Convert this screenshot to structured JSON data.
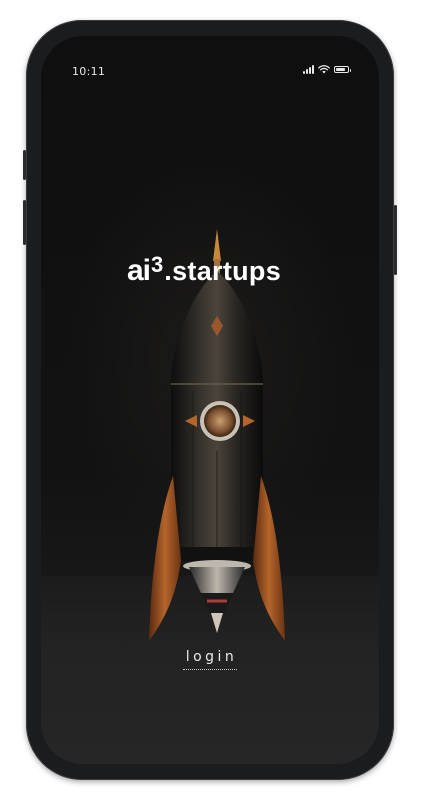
{
  "status_bar": {
    "time": "10:11",
    "signal_icon": "cellular-signal-icon",
    "wifi_icon": "wifi-icon",
    "battery_icon": "battery-icon",
    "battery_level": 0.85
  },
  "brand": {
    "logo_prefix": "ai",
    "logo_superscript": "3",
    "logo_suffix": ".startups"
  },
  "hero": {
    "illustration": "rocket-illustration"
  },
  "actions": {
    "login_label": "login"
  },
  "colors": {
    "background": "#121212",
    "text": "#ffffff",
    "accent_copper": "#b5652b"
  }
}
